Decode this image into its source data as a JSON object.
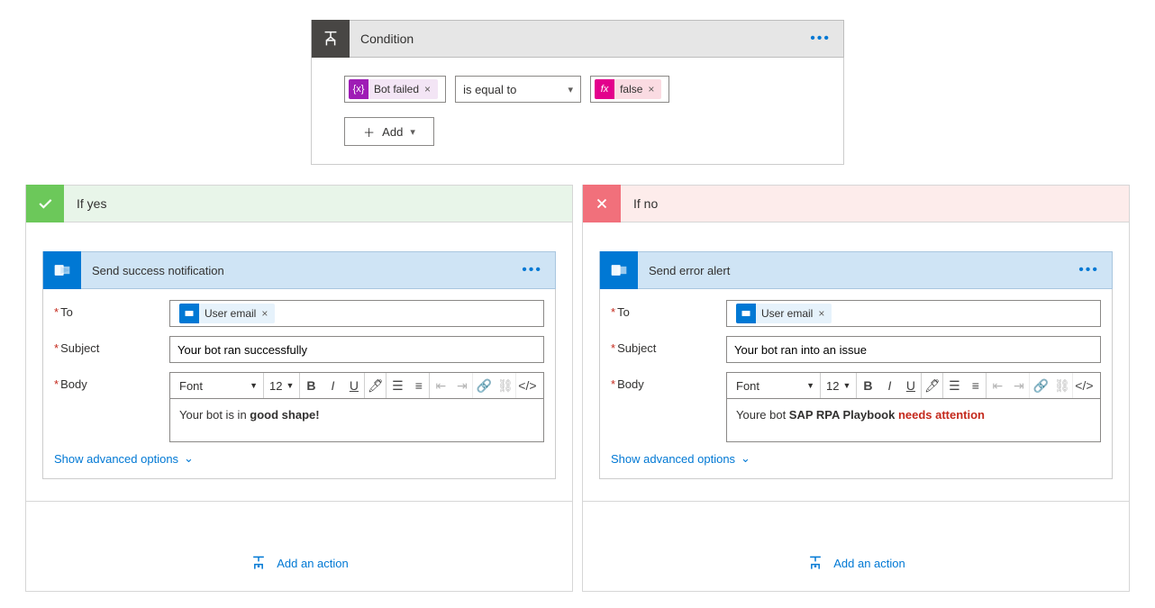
{
  "condition": {
    "title": "Condition",
    "left_pill": "Bot failed",
    "operator": "is equal to",
    "right_pill": "false",
    "add_label": "Add",
    "fx_label": "fx",
    "brace_label": "{x}"
  },
  "yes_branch": {
    "title": "If yes"
  },
  "no_branch": {
    "title": "If no"
  },
  "success_action": {
    "title": "Send success notification",
    "to_label": "To",
    "to_pill": "User email",
    "subject_label": "Subject",
    "subject_value": "Your bot ran successfully",
    "body_label": "Body",
    "font_name": "Font",
    "font_size": "12",
    "body_prefix": "Your bot is in ",
    "body_strong": "good shape!"
  },
  "error_action": {
    "title": "Send error alert",
    "to_label": "To",
    "to_pill": "User email",
    "subject_label": "Subject",
    "subject_value": "Your bot ran into an issue",
    "body_label": "Body",
    "font_name": "Font",
    "font_size": "12",
    "body_p1": "Youre bot ",
    "body_strong": "SAP RPA Playbook",
    "body_p2": " ",
    "body_attention": "needs attention"
  },
  "common": {
    "show_advanced": "Show advanced options",
    "add_action": "Add an action"
  }
}
